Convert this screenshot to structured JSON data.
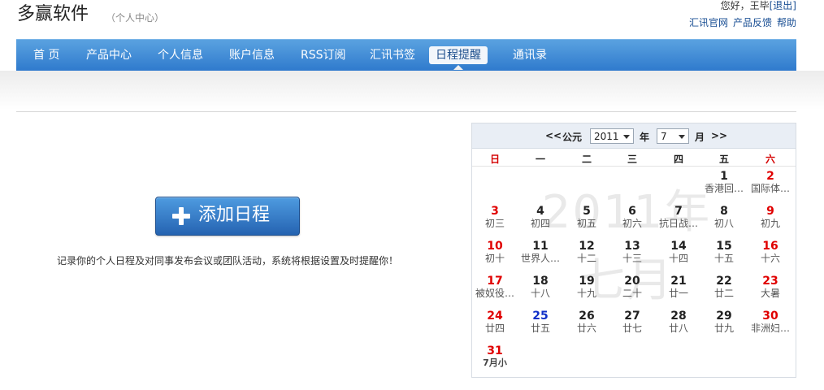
{
  "header": {
    "brand": "多赢软件",
    "subtitle": "（个人中心）",
    "greeting": "您好，王毕",
    "logout": "[退出]",
    "links": [
      "汇讯官网",
      "产品反馈",
      "帮助"
    ]
  },
  "nav": {
    "items": [
      "首 页",
      "产品中心",
      "个人信息",
      "账户信息",
      "RSS订阅",
      "汇讯书签",
      "日程提醒",
      "通讯录"
    ],
    "active_index": 6
  },
  "add_button": {
    "label": "添加日程",
    "icon": "plus-icon"
  },
  "description": "记录你的个人日程及对同事发布会议或团队活动，系统将根据设置及时提醒你！",
  "calendar": {
    "prev": "<<",
    "era": "公元",
    "year": "2011",
    "year_unit": "年",
    "month": "7",
    "month_unit": "月",
    "next": ">>",
    "weekdays": [
      "日",
      "一",
      "二",
      "三",
      "四",
      "五",
      "六"
    ],
    "watermark": "2011年\n七月",
    "days": [
      {
        "d": "1",
        "l": "香港回…",
        "c": "normal"
      },
      {
        "d": "2",
        "l": "国际体…",
        "c": "red"
      },
      {
        "d": "3",
        "l": "初三",
        "c": "red"
      },
      {
        "d": "4",
        "l": "初四",
        "c": "normal"
      },
      {
        "d": "5",
        "l": "初五",
        "c": "normal"
      },
      {
        "d": "6",
        "l": "初六",
        "c": "normal"
      },
      {
        "d": "7",
        "l": "抗日战…",
        "c": "normal"
      },
      {
        "d": "8",
        "l": "初八",
        "c": "normal"
      },
      {
        "d": "9",
        "l": "初九",
        "c": "red"
      },
      {
        "d": "10",
        "l": "初十",
        "c": "red"
      },
      {
        "d": "11",
        "l": "世界人…",
        "c": "normal"
      },
      {
        "d": "12",
        "l": "十二",
        "c": "normal"
      },
      {
        "d": "13",
        "l": "十三",
        "c": "normal"
      },
      {
        "d": "14",
        "l": "十四",
        "c": "normal"
      },
      {
        "d": "15",
        "l": "十五",
        "c": "normal"
      },
      {
        "d": "16",
        "l": "十六",
        "c": "red"
      },
      {
        "d": "17",
        "l": "被奴役…",
        "c": "red"
      },
      {
        "d": "18",
        "l": "十八",
        "c": "normal"
      },
      {
        "d": "19",
        "l": "十九",
        "c": "normal"
      },
      {
        "d": "20",
        "l": "二十",
        "c": "normal"
      },
      {
        "d": "21",
        "l": "廿一",
        "c": "normal"
      },
      {
        "d": "22",
        "l": "廿二",
        "c": "normal"
      },
      {
        "d": "23",
        "l": "大暑",
        "c": "red"
      },
      {
        "d": "24",
        "l": "廿四",
        "c": "red"
      },
      {
        "d": "25",
        "l": "廿五",
        "c": "blue"
      },
      {
        "d": "26",
        "l": "廿六",
        "c": "normal"
      },
      {
        "d": "27",
        "l": "廿七",
        "c": "normal"
      },
      {
        "d": "28",
        "l": "廿八",
        "c": "normal"
      },
      {
        "d": "29",
        "l": "廿九",
        "c": "normal"
      },
      {
        "d": "30",
        "l": "非洲妇…",
        "c": "red"
      },
      {
        "d": "31",
        "l": "7月小",
        "c": "red small"
      }
    ]
  }
}
